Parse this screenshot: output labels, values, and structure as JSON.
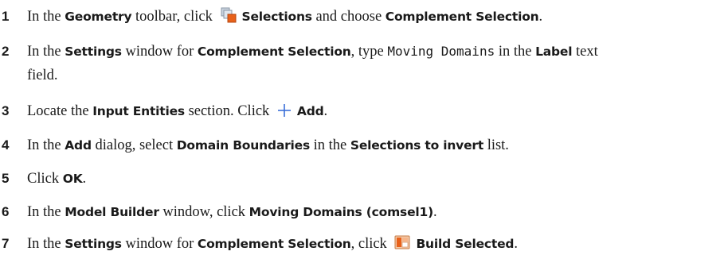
{
  "steps": [
    {
      "number": "1",
      "parts": [
        "In the ",
        "Geometry",
        " toolbar, click ",
        "Selections",
        " and choose ",
        "Complement Selection",
        "."
      ],
      "icon": "selections-icon"
    },
    {
      "number": "2",
      "parts": [
        "In the ",
        "Settings",
        " window for ",
        "Complement Selection",
        ", type ",
        "Moving Domains",
        " in the ",
        "Label",
        " text",
        "field."
      ]
    },
    {
      "number": "3",
      "parts": [
        "Locate the ",
        "Input Entities",
        " section. Click ",
        "Add",
        "."
      ],
      "icon": "add-icon"
    },
    {
      "number": "4",
      "parts": [
        "In the ",
        "Add",
        " dialog, select ",
        "Domain Boundaries",
        " in the ",
        "Selections to invert",
        " list."
      ]
    },
    {
      "number": "5",
      "parts": [
        "Click ",
        "OK",
        "."
      ]
    },
    {
      "number": "6",
      "parts": [
        "In the ",
        "Model Builder",
        " window, click ",
        "Moving Domains (comsel1)",
        "."
      ]
    },
    {
      "number": "7",
      "parts": [
        "In the ",
        "Settings",
        " window for ",
        "Complement Selection",
        ", click ",
        "Build Selected",
        "."
      ],
      "icon": "build-selected-icon"
    }
  ],
  "colors": {
    "text": "#1a1a1a",
    "add_icon_blue": "#3b6fd8",
    "selection_orange": "#e8611a"
  }
}
